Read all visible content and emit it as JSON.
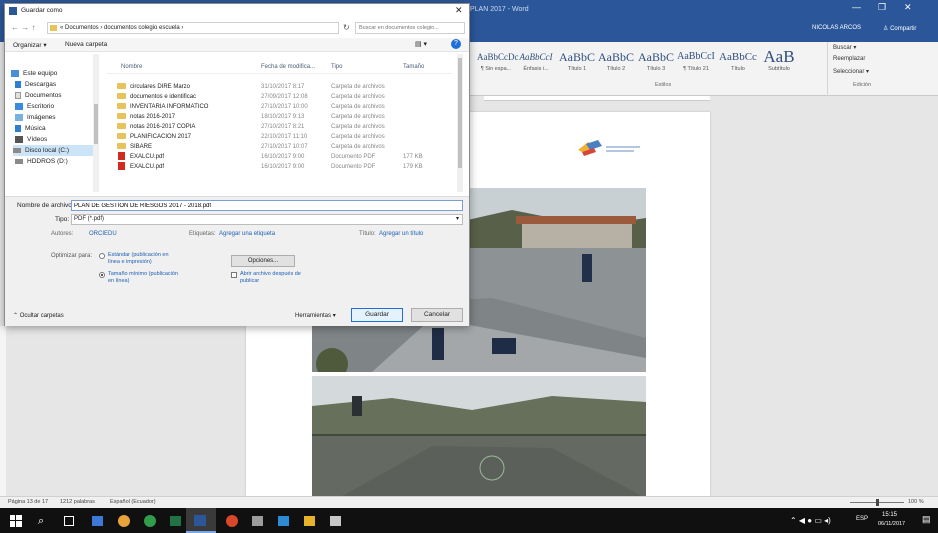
{
  "dialog": {
    "title": "Guardar como",
    "breadcrumb": "« Documentos › documentos colegio escuela ›",
    "search_placeholder": "Buscar en documentos colegio...",
    "organize_label": "Organizar ▾",
    "new_folder_label": "Nueva carpeta",
    "nav": [
      {
        "label": "Este equipo",
        "icon": "computer-icon"
      },
      {
        "label": "Descargas",
        "icon": "download-icon"
      },
      {
        "label": "Documentos",
        "icon": "documents-icon"
      },
      {
        "label": "Escritorio",
        "icon": "desktop-icon"
      },
      {
        "label": "Imágenes",
        "icon": "pictures-icon"
      },
      {
        "label": "Música",
        "icon": "music-icon"
      },
      {
        "label": "Vídeos",
        "icon": "videos-icon"
      },
      {
        "label": "Disco local (C:)",
        "icon": "drive-icon"
      },
      {
        "label": "HDDROS (D:)",
        "icon": "drive-icon"
      }
    ],
    "columns": [
      "Nombre",
      "Fecha de modifica...",
      "Tipo",
      "Tamaño"
    ],
    "files": [
      {
        "name": "circulares DIRE Marzo",
        "date": "31/10/2017 8:17",
        "type": "Carpeta de archivos",
        "size": "",
        "kind": "folder"
      },
      {
        "name": "documentos e identificac",
        "date": "27/09/2017 12:08",
        "type": "Carpeta de archivos",
        "size": "",
        "kind": "folder"
      },
      {
        "name": "INVENTARIA INFORMATICO",
        "date": "27/10/2017 10:00",
        "type": "Carpeta de archivos",
        "size": "",
        "kind": "folder"
      },
      {
        "name": "notas 2016-2017",
        "date": "18/10/2017 9:13",
        "type": "Carpeta de archivos",
        "size": "",
        "kind": "folder"
      },
      {
        "name": "notas 2016-2017 COPIA",
        "date": "27/10/2017 8:21",
        "type": "Carpeta de archivos",
        "size": "",
        "kind": "folder"
      },
      {
        "name": "PLANIFICACION 2017",
        "date": "22/10/2017 11:10",
        "type": "Carpeta de archivos",
        "size": "",
        "kind": "folder"
      },
      {
        "name": "SIBARE",
        "date": "27/10/2017 10:07",
        "type": "Carpeta de archivos",
        "size": "",
        "kind": "folder"
      },
      {
        "name": "EXALCU.pdf",
        "date": "16/10/2017 9:00",
        "type": "Documento PDF",
        "size": "177 KB",
        "kind": "pdf"
      },
      {
        "name": "EXALCU.pdf",
        "date": "16/10/2017 9:00",
        "type": "Documento PDF",
        "size": "179 KB",
        "kind": "pdf"
      }
    ],
    "filename_label": "Nombre de archivo:",
    "filename_value": "PLAN DE GESTION DE RIESGOS 2017 - 2018.pdf",
    "type_label": "Tipo:",
    "type_value": "PDF (*.pdf)",
    "authors_label": "Autores:",
    "authors_value": "ORCIEDU",
    "tags_label": "Etiquetas:",
    "tags_value": "Agregar una etiqueta",
    "title_label": "Título:",
    "title_value": "Agregar un título",
    "optimize_label": "Optimizar para:",
    "optimize_standard": "Estándar (publicación en línea e impresión)",
    "optimize_minimum": "Tamaño mínimo (publicación en línea)",
    "options_label": "Opciones...",
    "open_after_label": "Abrir archivo después de publicar",
    "hide_folders_label": "Ocultar carpetas",
    "tools_label": "Herramientas",
    "save_label": "Guardar",
    "cancel_label": "Cancelar"
  },
  "word": {
    "title": "PLAN 2017 - Word",
    "user": "NICOLAS ARCOS",
    "share": "Compartir",
    "styles": [
      {
        "sample": "AaBbCcDc",
        "name": "¶ Sin espa..."
      },
      {
        "sample": "AaBbCcI",
        "name": "Énfasis i..."
      },
      {
        "sample": "AaBbC",
        "name": "Título 1"
      },
      {
        "sample": "AaBbC",
        "name": "Título 2"
      },
      {
        "sample": "AaBbC",
        "name": "Título 3"
      },
      {
        "sample": "AaBbCcI",
        "name": "¶ Título 21"
      },
      {
        "sample": "AaBbCc",
        "name": "Título"
      },
      {
        "sample": "AaB",
        "name": "Subtítulo"
      }
    ],
    "styles_group": "Estilos",
    "editing": [
      "Buscar ▾",
      "Reemplazar",
      "Seleccionar ▾"
    ],
    "editing_group": "Edición",
    "status_page": "Página 13 de 17",
    "status_words": "1212 palabras",
    "status_lang": "Español (Ecuador)",
    "zoom": "100 %"
  },
  "taskbar": {
    "time": "15:15",
    "date": "06/11/2017",
    "lang": "ESP"
  }
}
